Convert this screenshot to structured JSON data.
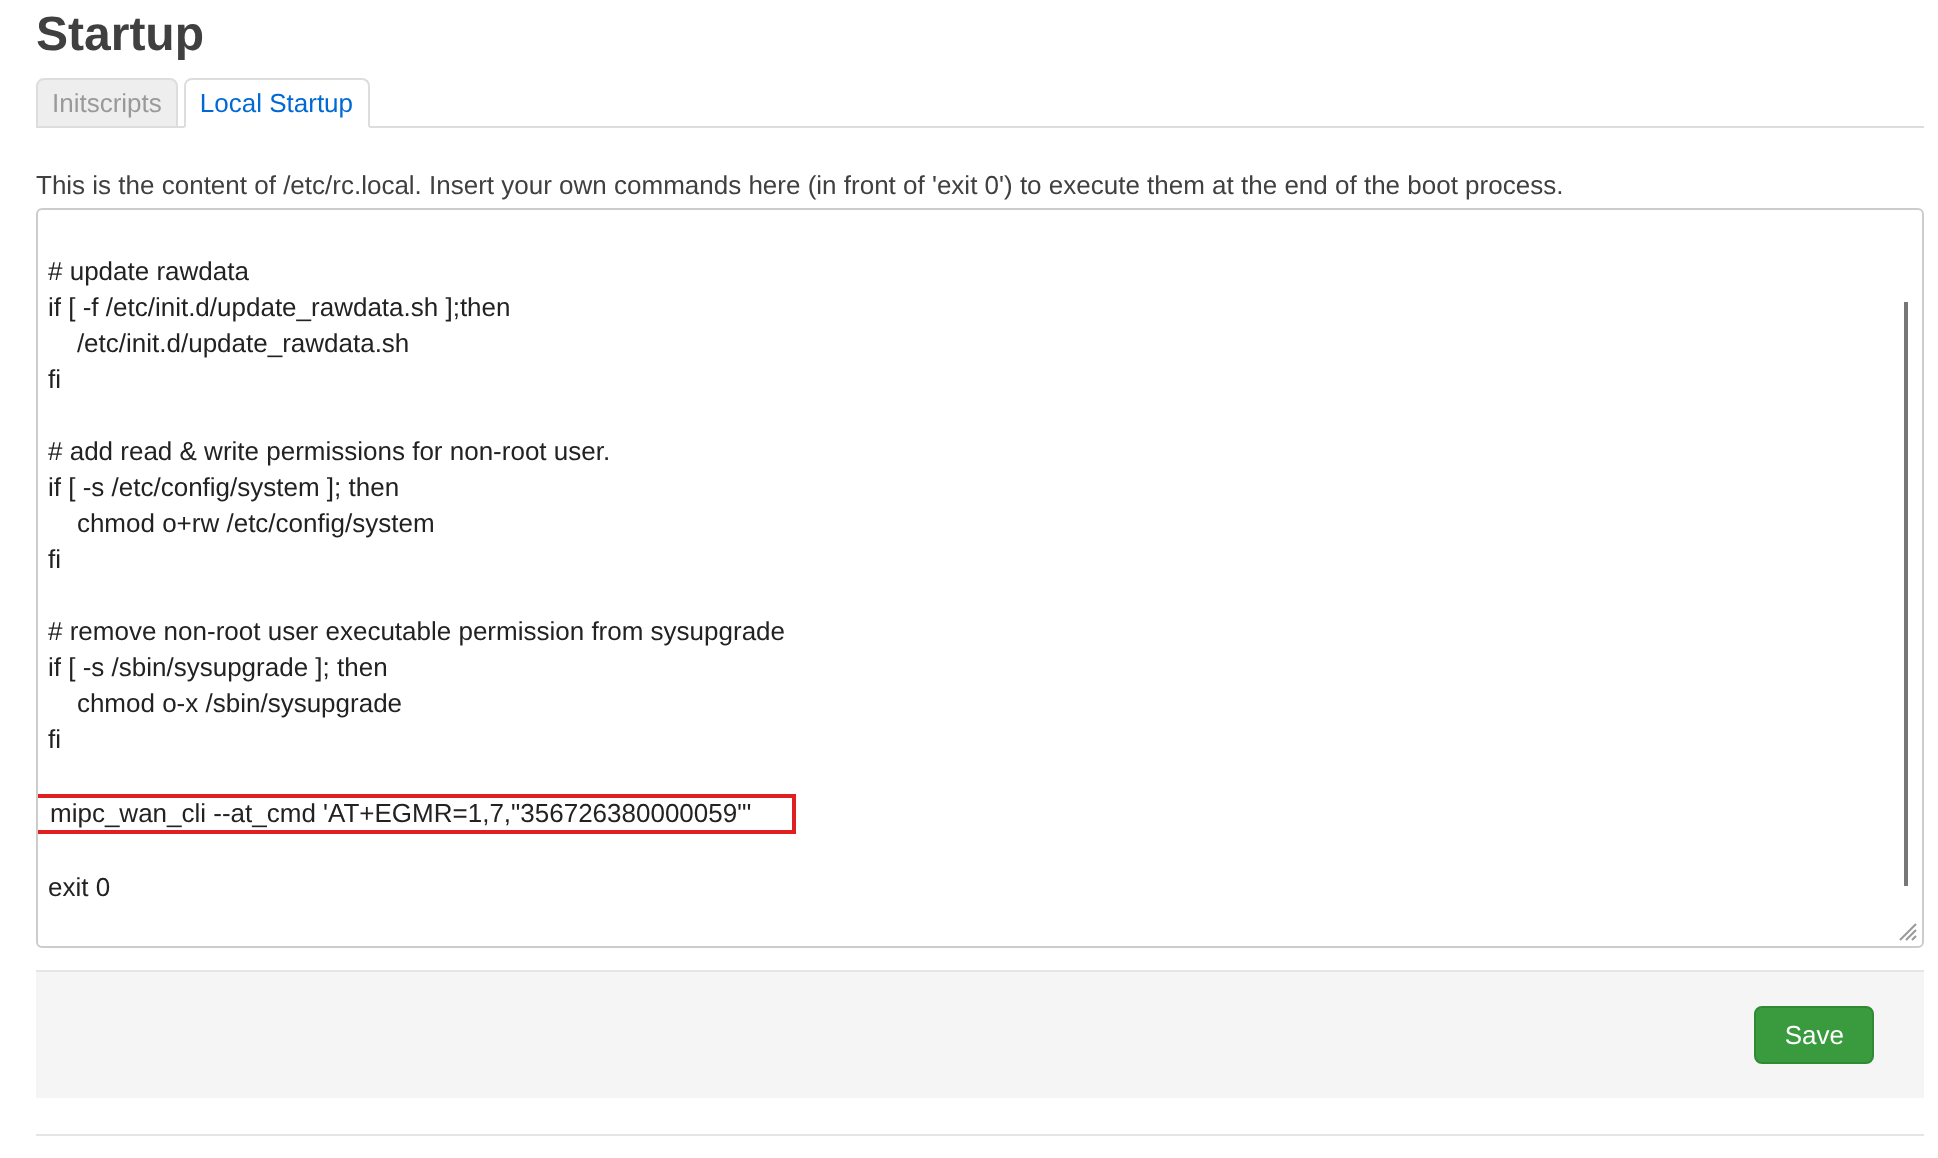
{
  "page": {
    "title": "Startup"
  },
  "tabs": [
    {
      "label": "Initscripts",
      "selected": false
    },
    {
      "label": "Local Startup",
      "selected": true
    }
  ],
  "description": "This is the content of /etc/rc.local. Insert your own commands here (in front of 'exit 0') to execute them at the end of the boot process.",
  "editor": {
    "blocks": [
      {
        "lines": [
          "# update rawdata",
          "if [ -f /etc/init.d/update_rawdata.sh ];then",
          "    /etc/init.d/update_rawdata.sh",
          "fi"
        ],
        "highlighted": false
      },
      {
        "lines": [
          "# add read & write permissions for non-root user.",
          "if [ -s /etc/config/system ]; then",
          "    chmod o+rw /etc/config/system",
          "fi"
        ],
        "highlighted": false
      },
      {
        "lines": [
          "# remove non-root user executable permission from sysupgrade",
          "if [ -s /sbin/sysupgrade ]; then",
          "    chmod o-x /sbin/sysupgrade",
          "fi"
        ],
        "highlighted": false
      },
      {
        "lines": [
          "mipc_wan_cli --at_cmd 'AT+EGMR=1,7,\"356726380000059\"'"
        ],
        "highlighted": true
      },
      {
        "lines": [
          "exit 0"
        ],
        "highlighted": false
      }
    ]
  },
  "actions": {
    "save": "Save"
  }
}
